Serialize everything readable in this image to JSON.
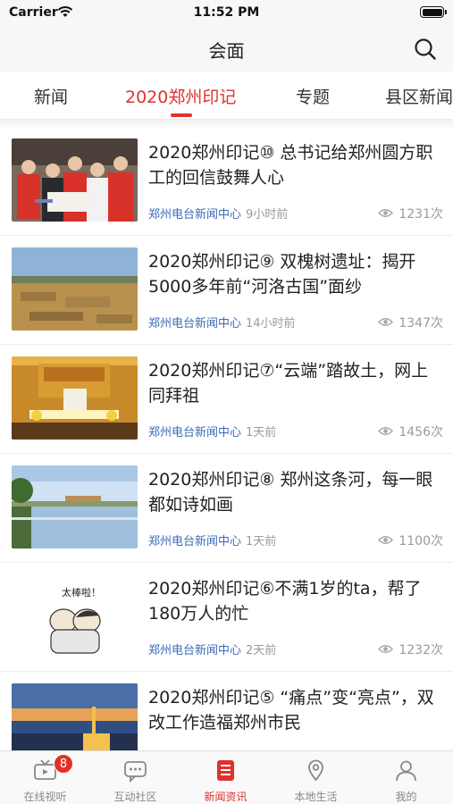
{
  "status_bar": {
    "carrier": "Carrier",
    "time": "11:52 PM"
  },
  "nav": {
    "title": "会面",
    "search_icon": "search-icon"
  },
  "tabs": [
    {
      "label": "新闻",
      "active": false
    },
    {
      "label": "2020郑州印记",
      "active": true
    },
    {
      "label": "专题",
      "active": false
    },
    {
      "label": "县区新闻",
      "active": false
    }
  ],
  "articles": [
    {
      "title": "2020郑州印记⑩ 总书记给郑州圆方职工的回信鼓舞人心",
      "source": "郑州电台新闻中心",
      "time": "9小时前",
      "views": "1231次"
    },
    {
      "title": "2020郑州印记⑨ 双槐树遗址：揭开5000多年前“河洛古国”面纱",
      "source": "郑州电台新闻中心",
      "time": "14小时前",
      "views": "1347次"
    },
    {
      "title": "2020郑州印记⑦“云端”踏故土，网上同拜祖",
      "source": "郑州电台新闻中心",
      "time": "1天前",
      "views": "1456次"
    },
    {
      "title": "2020郑州印记⑧ 郑州这条河，每一眼都如诗如画",
      "source": "郑州电台新闻中心",
      "time": "1天前",
      "views": "1100次"
    },
    {
      "title": "2020郑州印记⑥不满1岁的ta，帮了180万人的忙",
      "source": "郑州电台新闻中心",
      "time": "2天前",
      "views": "1232次"
    },
    {
      "title": "2020郑州印记⑤ “痛点”变“亮点”，双改工作造福郑州市民",
      "source": "",
      "time": "",
      "views": ""
    }
  ],
  "thumb_5_text": "太棒啦！",
  "tab_bar": [
    {
      "label": "在线视听",
      "icon": "tv-icon",
      "badge": "8",
      "active": false
    },
    {
      "label": "互动社区",
      "icon": "chat-icon",
      "active": false
    },
    {
      "label": "新闻资讯",
      "icon": "news-icon",
      "active": true
    },
    {
      "label": "本地生活",
      "icon": "location-icon",
      "active": false
    },
    {
      "label": "我的",
      "icon": "person-icon",
      "active": false
    }
  ],
  "colors": {
    "accent": "#e0322d",
    "source": "#3b6bb8",
    "muted": "#9a9a9a"
  }
}
